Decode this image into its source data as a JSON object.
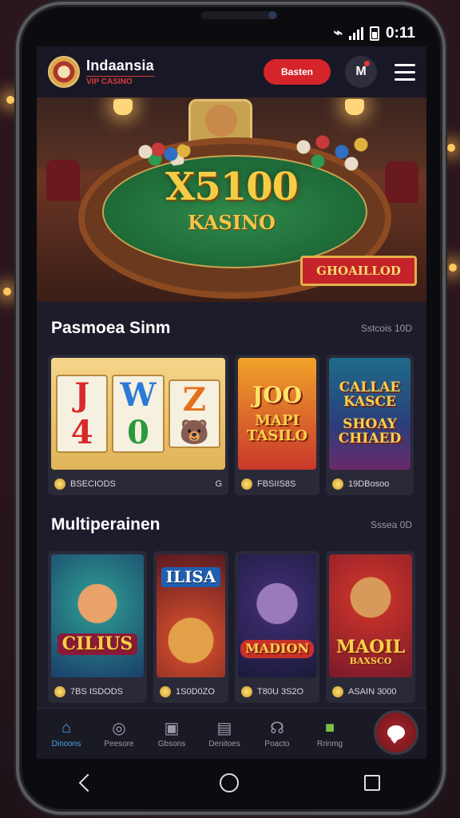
{
  "status_bar": {
    "time": "0:11"
  },
  "header": {
    "brand_name": "Indaansia",
    "brand_sub": "VIP CASINO",
    "primary_button": "Basten",
    "user_button": "M"
  },
  "hero": {
    "title": "X5100",
    "subtitle": "KASINO",
    "banner": "GHOAILLOD"
  },
  "sections": [
    {
      "title": "Pasmoea Sinm",
      "link": "Sstcois 10D",
      "cards": [
        {
          "footer": "BSECIODS",
          "extra": "G",
          "reels": [
            "J",
            "W",
            "Z",
            "4",
            "0",
            "🐻"
          ]
        },
        {
          "art_top": "JOO",
          "art_bottom": "MAPI TASILO",
          "footer": "FBSIIS8S"
        },
        {
          "art_top": "CALLAE KASCE",
          "art_bottom": "SHOAY CHIAED",
          "footer": "19DBosoo"
        }
      ]
    },
    {
      "title": "Multiperainen",
      "link": "Sssea 0D",
      "cards": [
        {
          "art_bottom": "CILIUS",
          "footer": "7BS ISDODS"
        },
        {
          "art_top": "ILISA",
          "footer": "1S0D0ZO"
        },
        {
          "art_bottom": "MADION",
          "footer": "T80U 3S2O"
        },
        {
          "art_top": "MAOIL",
          "art_bottom": "BAXSCO",
          "footer": "ASAIN 3000"
        }
      ]
    }
  ],
  "bottom_nav": [
    {
      "label": "Dinoons",
      "icon": "home-icon",
      "active": true
    },
    {
      "label": "Peesore",
      "icon": "compass-icon",
      "active": false
    },
    {
      "label": "Gbsons",
      "icon": "bag-icon",
      "active": false
    },
    {
      "label": "Denitoes",
      "icon": "document-icon",
      "active": false
    },
    {
      "label": "Poacto",
      "icon": "headset-icon",
      "active": false
    },
    {
      "label": "Rrinmg",
      "icon": "gift-icon",
      "active": false
    }
  ],
  "colors": {
    "accent": "#d5252b",
    "nav_active": "#4aa3e8",
    "gold": "#f5cc45",
    "background": "#1d1c2b"
  }
}
